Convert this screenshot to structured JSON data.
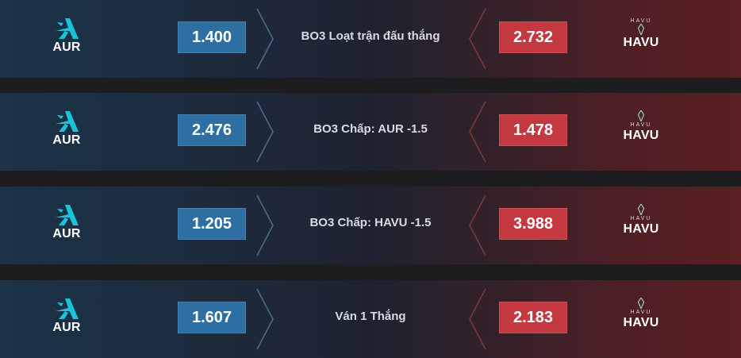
{
  "colors": {
    "home_odds_bg": "#2e6fa3",
    "away_odds_bg": "#c3393f",
    "home_logo": "#19c3d8",
    "away_logo": "#9fd6c4"
  },
  "rows": [
    {
      "home": {
        "abbr": "AUR",
        "logo_icon": "aurora-logo-icon"
      },
      "home_odds": "1.400",
      "market": "BO3 Loạt trận đấu thắng",
      "away_odds": "2.732",
      "away": {
        "abbr": "HAVU",
        "wordmark": "HAVU",
        "logo_icon": "havu-logo-icon"
      }
    },
    {
      "home": {
        "abbr": "AUR",
        "logo_icon": "aurora-logo-icon"
      },
      "home_odds": "2.476",
      "market": "BO3 Chấp: AUR -1.5",
      "away_odds": "1.478",
      "away": {
        "abbr": "HAVU",
        "wordmark": "HAVU",
        "logo_icon": "havu-logo-icon"
      }
    },
    {
      "home": {
        "abbr": "AUR",
        "logo_icon": "aurora-logo-icon"
      },
      "home_odds": "1.205",
      "market": "BO3 Chấp: HAVU -1.5",
      "away_odds": "3.988",
      "away": {
        "abbr": "HAVU",
        "wordmark": "HAVU",
        "logo_icon": "havu-logo-icon"
      }
    },
    {
      "home": {
        "abbr": "AUR",
        "logo_icon": "aurora-logo-icon"
      },
      "home_odds": "1.607",
      "market": "Ván 1 Thắng",
      "away_odds": "2.183",
      "away": {
        "abbr": "HAVU",
        "wordmark": "HAVU",
        "logo_icon": "havu-logo-icon"
      }
    }
  ]
}
